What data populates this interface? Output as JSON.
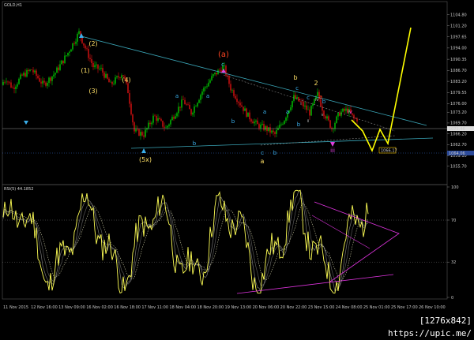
{
  "chart_data": [
    {
      "type": "candlestick",
      "title": "GOLD,H1",
      "ylim": [
        1050.0,
        1107.0
      ],
      "y_ticks": [
        "1104.80",
        "1101.20",
        "1097.65",
        "1094.00",
        "1090.35",
        "1086.70",
        "1083.20",
        "1079.55",
        "1076.00",
        "1073.20",
        "1069.70",
        "1066.20",
        "1062.70",
        "1059.10",
        "1055.70"
      ],
      "x_ticks": [
        "11 Nov 2015",
        "12 Nov 16:00",
        "13 Nov 09:00",
        "16 Nov 02:00",
        "16 Nov 18:00",
        "17 Nov 11:00",
        "18 Nov 04:00",
        "18 Nov 20:00",
        "19 Nov 13:00",
        "20 Nov 06:00",
        "20 Nov 22:00",
        "23 Nov 15:00",
        "24 Nov 08:00",
        "25 Nov 01:00",
        "25 Nov 17:00",
        "26 Nov 10:00"
      ],
      "price_labels": {
        "current": "1071.46",
        "line1": "1066.17",
        "line2": "1064.06"
      },
      "wave_labels_yellow": [
        "(2)",
        "(1)",
        "(3)",
        "(4)",
        "(5x)",
        "b",
        "2",
        "a"
      ],
      "wave_labels_red": [
        "(a)",
        "a"
      ],
      "wave_labels_blue": [
        "c",
        "a",
        "b",
        "a",
        "b",
        "c",
        "c",
        "a",
        "b",
        "a",
        "c",
        "b",
        "b"
      ],
      "wave_labels_magenta": [
        "iv",
        "iii"
      ],
      "annotations_small": [
        "i",
        "ii",
        "iv",
        "v"
      ],
      "colors": {
        "up": "#00cc00",
        "down": "#dd1111",
        "projection": "#ffff00",
        "trendline": "#3aa6b8",
        "rsi": "#ffff55",
        "triangle": "#dd33dd"
      }
    },
    {
      "type": "line",
      "title": "RSI(5) 44.1852",
      "ylim": [
        0,
        100
      ],
      "y_ticks": [
        "100",
        "70",
        "32",
        "0"
      ]
    }
  ],
  "watermark": "[1276x842] https://upic.me/"
}
